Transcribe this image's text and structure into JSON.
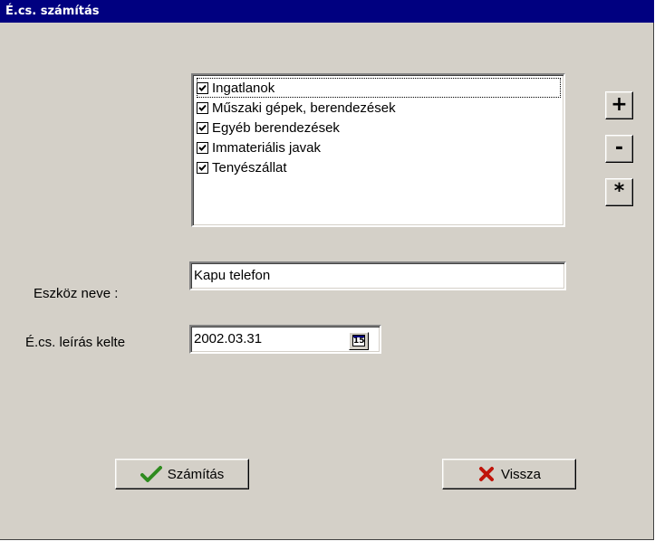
{
  "window": {
    "title": "É.cs. számítás"
  },
  "categories": {
    "items": [
      {
        "label": "Ingatlanok",
        "checked": true
      },
      {
        "label": "Műszaki gépek, berendezések",
        "checked": true
      },
      {
        "label": "Egyéb berendezések",
        "checked": true
      },
      {
        "label": "Immateriális javak",
        "checked": true
      },
      {
        "label": "Tenyészállat",
        "checked": true
      }
    ]
  },
  "side_buttons": {
    "add": "+",
    "remove": "-",
    "all": "*"
  },
  "asset_name": {
    "label": "Eszköz neve :",
    "value": "Kapu telefon"
  },
  "writeoff_date": {
    "label": "É.cs. leírás kelte",
    "value": "2002.03.31",
    "calendar_day": "15"
  },
  "actions": {
    "calculate": "Számítás",
    "back": "Vissza"
  },
  "colors": {
    "titlebar": "#000080",
    "face": "#d4d0c8",
    "check_icon": "#2e8b1f",
    "cross_icon": "#c0140a"
  }
}
